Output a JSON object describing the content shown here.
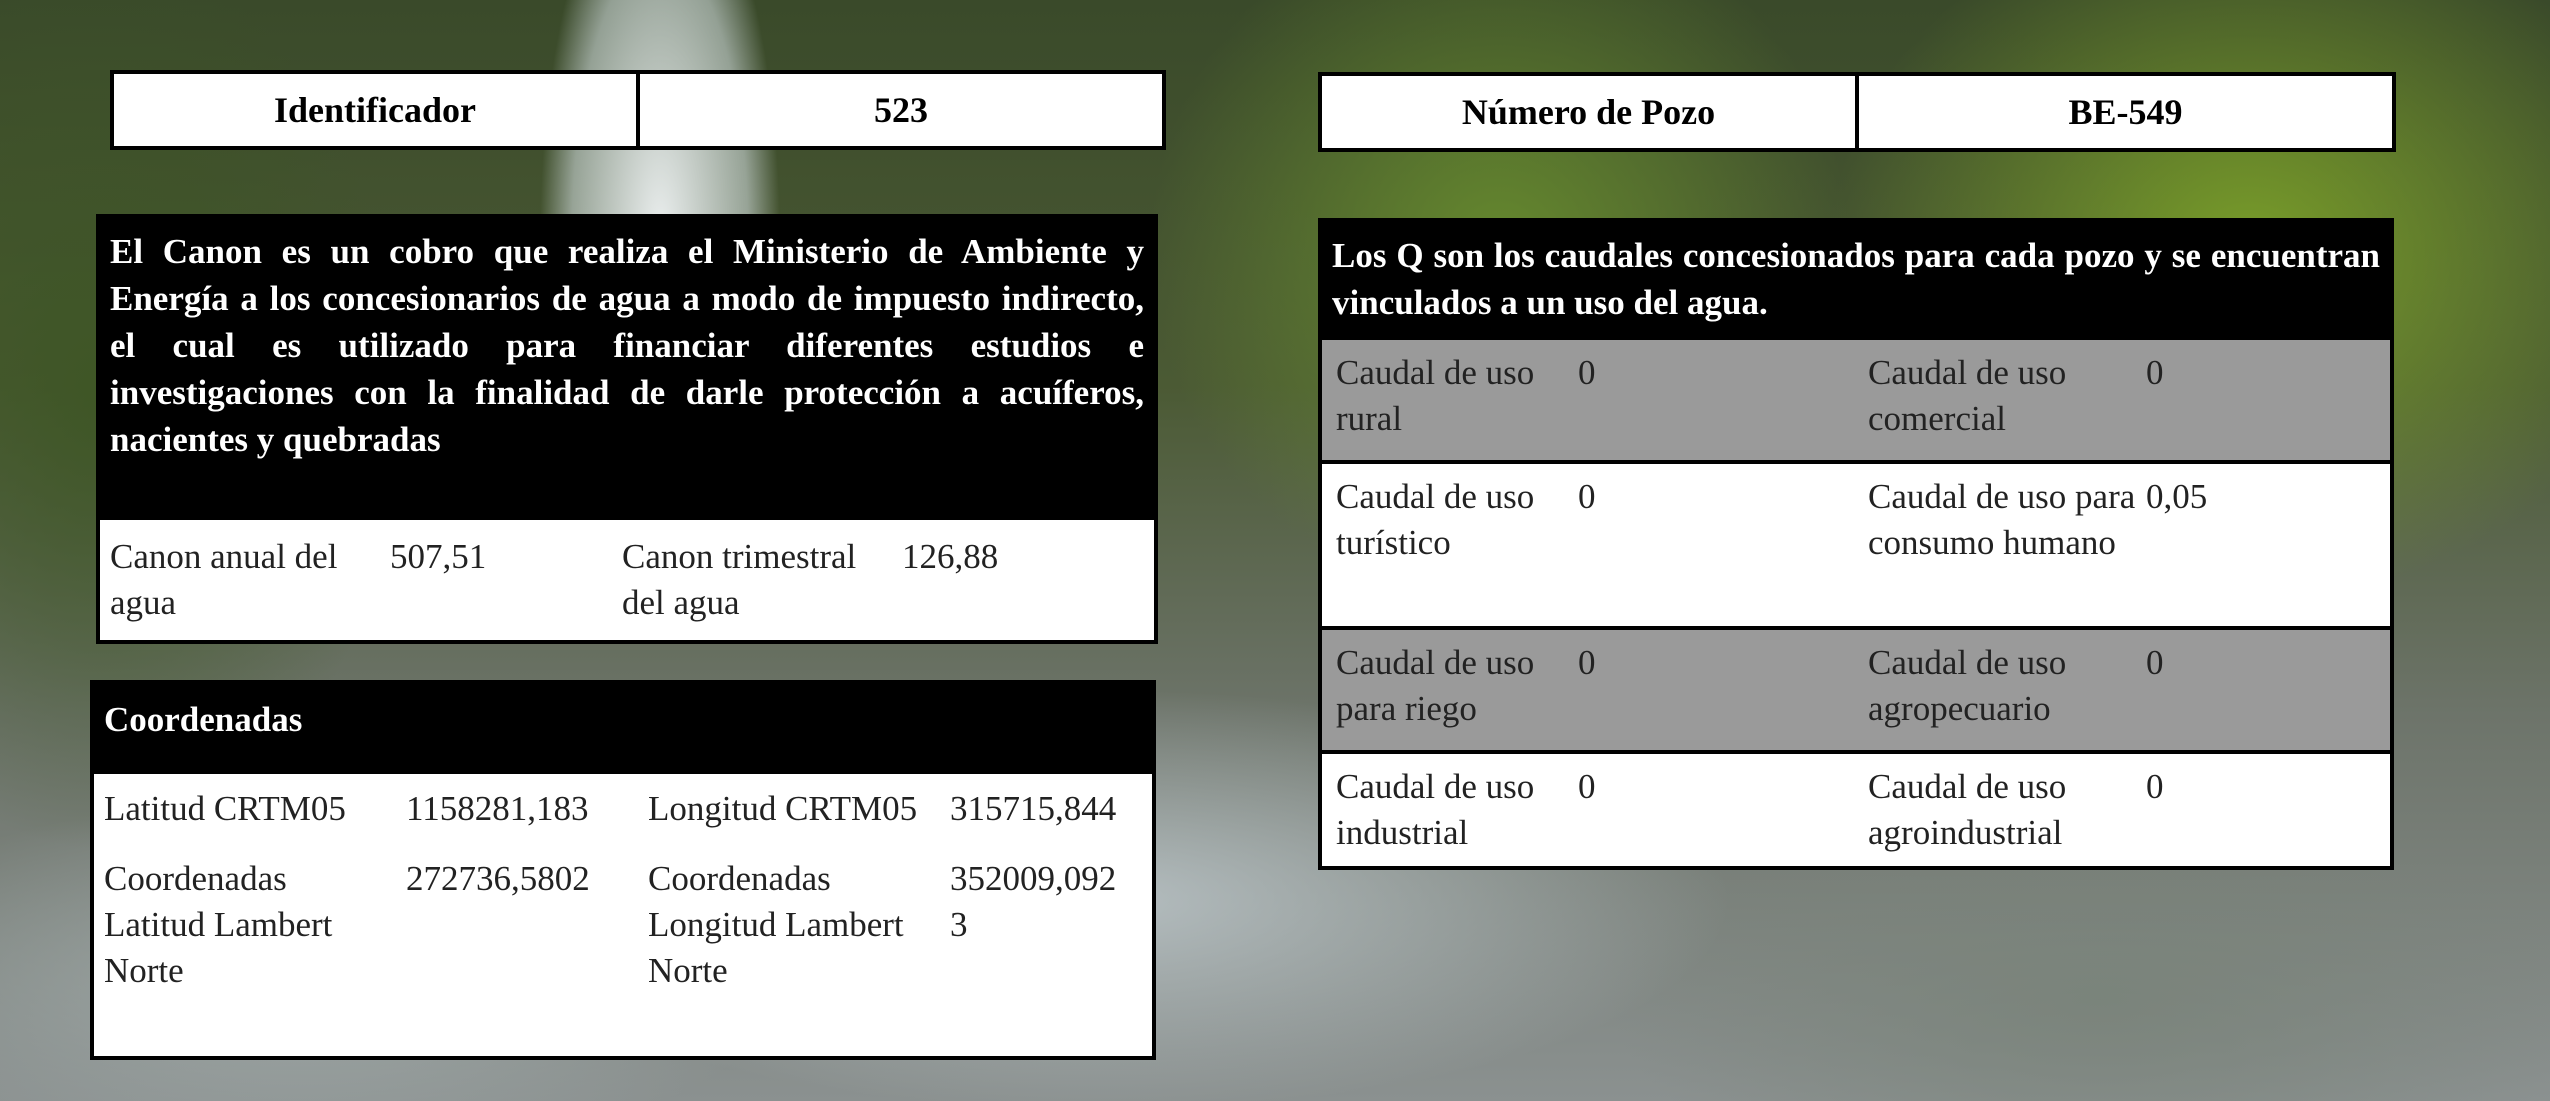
{
  "left_header": {
    "label": "Identificador",
    "value": "523"
  },
  "right_header": {
    "label": "Número de Pozo",
    "value": "BE-549"
  },
  "canon": {
    "description": "El Canon es un cobro que realiza el Ministerio de Ambiente y Energía a los concesionarios de agua a modo de impuesto indirecto, el cual es utilizado para financiar diferentes estudios e investigaciones con la finalidad de darle protección a acuíferos, nacientes y quebradas",
    "annual_label": "Canon anual del agua",
    "annual_value": "507,51",
    "quarterly_label": "Canon trimestral del agua",
    "quarterly_value": "126,88"
  },
  "coordinates": {
    "title": "Coordenadas",
    "lat_crtm_label": "Latitud CRTM05",
    "lat_crtm_value": "1158281,183",
    "lon_crtm_label": "Longitud CRTM05",
    "lon_crtm_value": "315715,844",
    "lat_lambert_label": "Coordenadas Latitud Lambert Norte",
    "lat_lambert_value": "272736,5802",
    "lon_lambert_label": "Coordenadas Longitud Lambert Norte",
    "lon_lambert_value": "352009,0923"
  },
  "flows": {
    "description": "Los Q son  los caudales  concesionados para cada pozo y se encuentran vinculados a un uso del agua.",
    "rows": [
      {
        "a_label": "Caudal de uso rural",
        "a_value": "0",
        "b_label": "Caudal de uso comercial",
        "b_value": "0"
      },
      {
        "a_label": "Caudal de uso turístico",
        "a_value": "0",
        "b_label": "Caudal de uso para consumo humano",
        "b_value": "0,05"
      },
      {
        "a_label": "Caudal de uso para riego",
        "a_value": "0",
        "b_label": "Caudal de uso agropecuario",
        "b_value": "0"
      },
      {
        "a_label": "Caudal de uso industrial",
        "a_value": "0",
        "b_label": "Caudal de uso agroindustrial",
        "b_value": "0"
      }
    ]
  }
}
